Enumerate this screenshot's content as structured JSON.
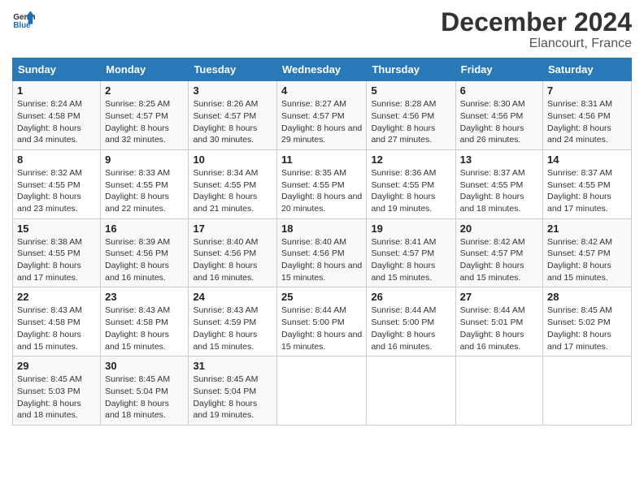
{
  "logo": {
    "general": "General",
    "blue": "Blue"
  },
  "title": {
    "month_year": "December 2024",
    "location": "Elancourt, France"
  },
  "headers": [
    "Sunday",
    "Monday",
    "Tuesday",
    "Wednesday",
    "Thursday",
    "Friday",
    "Saturday"
  ],
  "weeks": [
    [
      {
        "day": "1",
        "sunrise": "8:24 AM",
        "sunset": "4:58 PM",
        "daylight": "8 hours and 34 minutes."
      },
      {
        "day": "2",
        "sunrise": "8:25 AM",
        "sunset": "4:57 PM",
        "daylight": "8 hours and 32 minutes."
      },
      {
        "day": "3",
        "sunrise": "8:26 AM",
        "sunset": "4:57 PM",
        "daylight": "8 hours and 30 minutes."
      },
      {
        "day": "4",
        "sunrise": "8:27 AM",
        "sunset": "4:57 PM",
        "daylight": "8 hours and 29 minutes."
      },
      {
        "day": "5",
        "sunrise": "8:28 AM",
        "sunset": "4:56 PM",
        "daylight": "8 hours and 27 minutes."
      },
      {
        "day": "6",
        "sunrise": "8:30 AM",
        "sunset": "4:56 PM",
        "daylight": "8 hours and 26 minutes."
      },
      {
        "day": "7",
        "sunrise": "8:31 AM",
        "sunset": "4:56 PM",
        "daylight": "8 hours and 24 minutes."
      }
    ],
    [
      {
        "day": "8",
        "sunrise": "8:32 AM",
        "sunset": "4:55 PM",
        "daylight": "8 hours and 23 minutes."
      },
      {
        "day": "9",
        "sunrise": "8:33 AM",
        "sunset": "4:55 PM",
        "daylight": "8 hours and 22 minutes."
      },
      {
        "day": "10",
        "sunrise": "8:34 AM",
        "sunset": "4:55 PM",
        "daylight": "8 hours and 21 minutes."
      },
      {
        "day": "11",
        "sunrise": "8:35 AM",
        "sunset": "4:55 PM",
        "daylight": "8 hours and 20 minutes."
      },
      {
        "day": "12",
        "sunrise": "8:36 AM",
        "sunset": "4:55 PM",
        "daylight": "8 hours and 19 minutes."
      },
      {
        "day": "13",
        "sunrise": "8:37 AM",
        "sunset": "4:55 PM",
        "daylight": "8 hours and 18 minutes."
      },
      {
        "day": "14",
        "sunrise": "8:37 AM",
        "sunset": "4:55 PM",
        "daylight": "8 hours and 17 minutes."
      }
    ],
    [
      {
        "day": "15",
        "sunrise": "8:38 AM",
        "sunset": "4:55 PM",
        "daylight": "8 hours and 17 minutes."
      },
      {
        "day": "16",
        "sunrise": "8:39 AM",
        "sunset": "4:56 PM",
        "daylight": "8 hours and 16 minutes."
      },
      {
        "day": "17",
        "sunrise": "8:40 AM",
        "sunset": "4:56 PM",
        "daylight": "8 hours and 16 minutes."
      },
      {
        "day": "18",
        "sunrise": "8:40 AM",
        "sunset": "4:56 PM",
        "daylight": "8 hours and 15 minutes."
      },
      {
        "day": "19",
        "sunrise": "8:41 AM",
        "sunset": "4:57 PM",
        "daylight": "8 hours and 15 minutes."
      },
      {
        "day": "20",
        "sunrise": "8:42 AM",
        "sunset": "4:57 PM",
        "daylight": "8 hours and 15 minutes."
      },
      {
        "day": "21",
        "sunrise": "8:42 AM",
        "sunset": "4:57 PM",
        "daylight": "8 hours and 15 minutes."
      }
    ],
    [
      {
        "day": "22",
        "sunrise": "8:43 AM",
        "sunset": "4:58 PM",
        "daylight": "8 hours and 15 minutes."
      },
      {
        "day": "23",
        "sunrise": "8:43 AM",
        "sunset": "4:58 PM",
        "daylight": "8 hours and 15 minutes."
      },
      {
        "day": "24",
        "sunrise": "8:43 AM",
        "sunset": "4:59 PM",
        "daylight": "8 hours and 15 minutes."
      },
      {
        "day": "25",
        "sunrise": "8:44 AM",
        "sunset": "5:00 PM",
        "daylight": "8 hours and 15 minutes."
      },
      {
        "day": "26",
        "sunrise": "8:44 AM",
        "sunset": "5:00 PM",
        "daylight": "8 hours and 16 minutes."
      },
      {
        "day": "27",
        "sunrise": "8:44 AM",
        "sunset": "5:01 PM",
        "daylight": "8 hours and 16 minutes."
      },
      {
        "day": "28",
        "sunrise": "8:45 AM",
        "sunset": "5:02 PM",
        "daylight": "8 hours and 17 minutes."
      }
    ],
    [
      {
        "day": "29",
        "sunrise": "8:45 AM",
        "sunset": "5:03 PM",
        "daylight": "8 hours and 18 minutes."
      },
      {
        "day": "30",
        "sunrise": "8:45 AM",
        "sunset": "5:04 PM",
        "daylight": "8 hours and 18 minutes."
      },
      {
        "day": "31",
        "sunrise": "8:45 AM",
        "sunset": "5:04 PM",
        "daylight": "8 hours and 19 minutes."
      },
      null,
      null,
      null,
      null
    ]
  ]
}
